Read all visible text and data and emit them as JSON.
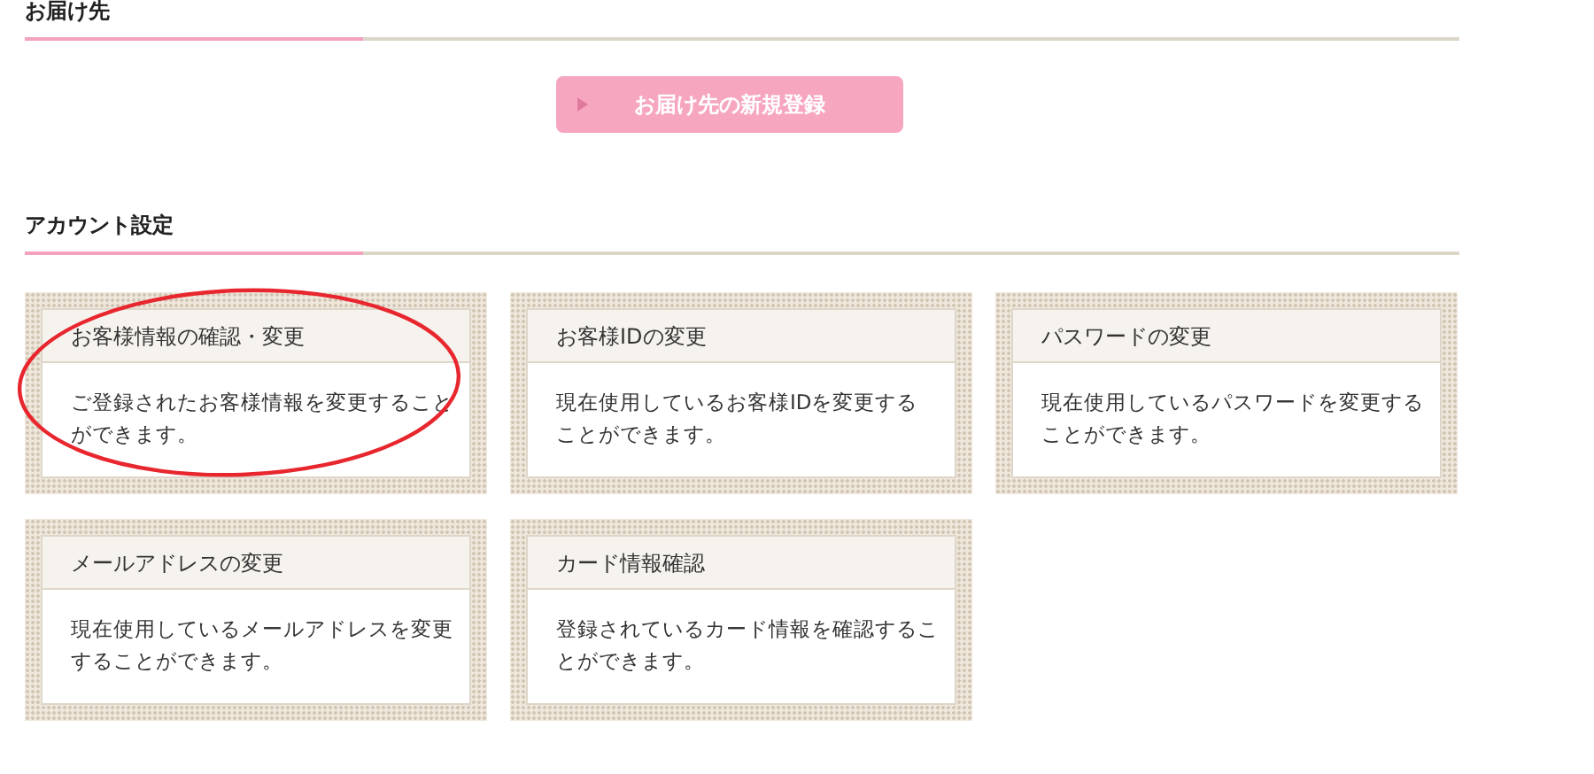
{
  "sections": [
    {
      "title": "お届け先",
      "button": "お届け先の新規登録"
    },
    {
      "title": "アカウント設定",
      "cards": [
        {
          "title": "お客様情報の確認・変更",
          "text": "ご登録されたお客様情報を変更することができます。",
          "circled": true
        },
        {
          "title": "お客様IDの変更",
          "text": "現在使用しているお客様IDを変更することができます。",
          "circled": false
        },
        {
          "title": "パスワードの変更",
          "text": "現在使用しているパスワードを変更することができます。",
          "circled": false
        },
        {
          "title": "メールアドレスの変更",
          "text": "現在使用しているメールアドレスを変更することができます。",
          "circled": false
        },
        {
          "title": "カード情報確認",
          "text": "登録されているカード情報を確認することができます。",
          "circled": false
        }
      ]
    }
  ]
}
